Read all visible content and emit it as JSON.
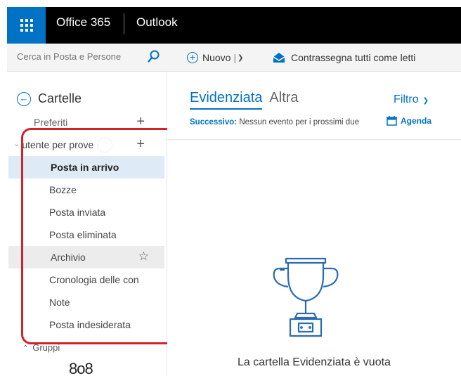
{
  "topbar": {
    "app_name": "Office 365",
    "module_name": "Outlook",
    "waffle_icon": "app-launcher-icon",
    "background": "#000000",
    "accent": "#0072c6"
  },
  "search": {
    "placeholder": "Cerca in Posta e Persone",
    "icon": "search-icon"
  },
  "commands": {
    "new_label": "Nuovo",
    "new_separator": "|",
    "mark_all_read_label": "Contrassegna tutti come letti"
  },
  "folders": {
    "header_label": "Cartelle",
    "favorites_label": "Preferiti",
    "add_symbol": "+",
    "account_label": "utente per prove",
    "items": [
      {
        "label": "Posta in arrivo",
        "selected": true
      },
      {
        "label": "Bozze"
      },
      {
        "label": "Posta inviata"
      },
      {
        "label": "Posta eliminata"
      },
      {
        "label": "Archivio",
        "star": "☆"
      },
      {
        "label": "Cronologia delle con"
      },
      {
        "label": "Note"
      },
      {
        "label": "Posta indesiderata"
      }
    ],
    "groups_caret": "^",
    "groups_label": "Gruppi",
    "groups_icon_glyph": "8ο8",
    "highlight_color": "#d3222a"
  },
  "message_list": {
    "tab_focused": "Evidenziata",
    "tab_other": "Altra",
    "filter_label": "Filtro",
    "next_label": "Successivo:",
    "next_text": "Nessun evento per i prossimi due",
    "agenda_label": "Agenda",
    "empty_text": "La cartella Evidenziata è vuota",
    "empty_icon": "trophy-icon"
  }
}
